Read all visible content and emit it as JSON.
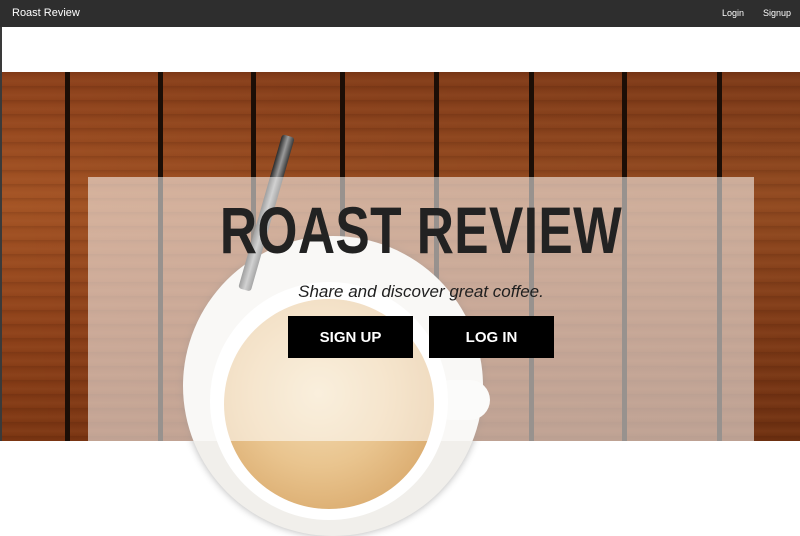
{
  "navbar": {
    "brand": "Roast Review",
    "links": [
      "Login",
      "Signup"
    ]
  },
  "hero": {
    "title": "ROAST REVIEW",
    "tagline": "Share and discover great coffee.",
    "signup_label": "SIGN UP",
    "login_label": "LOG IN"
  },
  "colors": {
    "navbar": "#2e2e2e",
    "button": "#000000",
    "title": "#222222"
  }
}
